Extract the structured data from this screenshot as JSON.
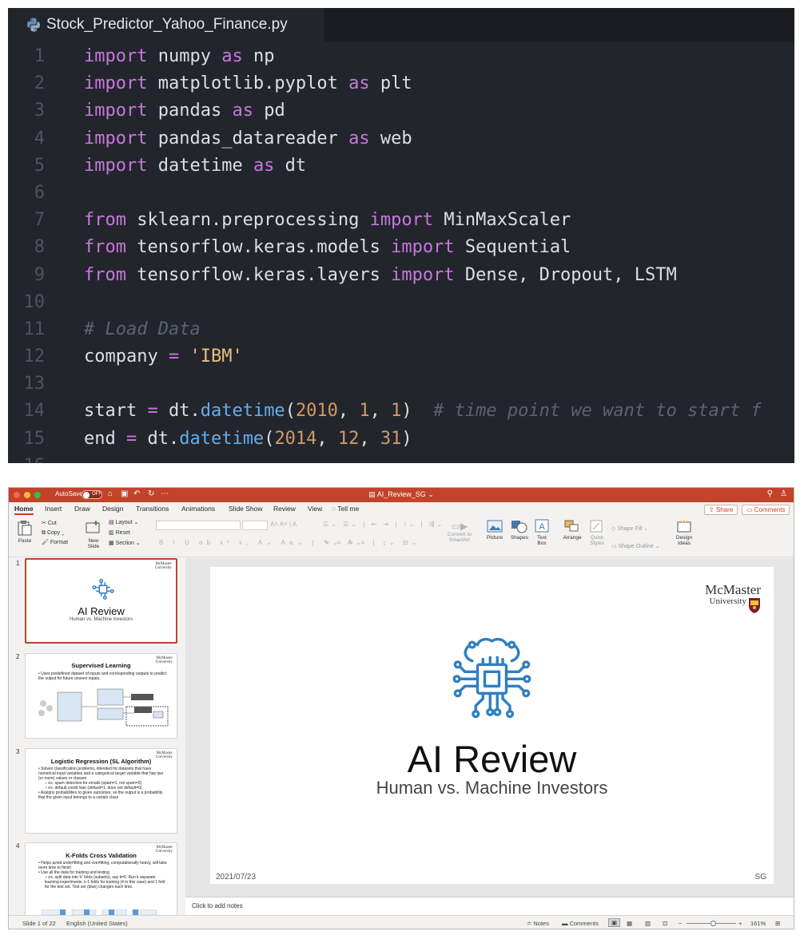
{
  "editor": {
    "filename": "Stock_Predictor_Yahoo_Finance.py",
    "lines": [
      {
        "n": "1",
        "tokens": [
          [
            "kw",
            "import"
          ],
          [
            "tx",
            " numpy "
          ],
          [
            "kw",
            "as"
          ],
          [
            "tx",
            " np"
          ]
        ]
      },
      {
        "n": "2",
        "tokens": [
          [
            "kw",
            "import"
          ],
          [
            "tx",
            " matplotlib.pyplot "
          ],
          [
            "kw",
            "as"
          ],
          [
            "tx",
            " plt"
          ]
        ]
      },
      {
        "n": "3",
        "tokens": [
          [
            "kw",
            "import"
          ],
          [
            "tx",
            " pandas "
          ],
          [
            "kw",
            "as"
          ],
          [
            "tx",
            " pd"
          ]
        ]
      },
      {
        "n": "4",
        "tokens": [
          [
            "kw",
            "import"
          ],
          [
            "tx",
            " pandas_datareader "
          ],
          [
            "kw",
            "as"
          ],
          [
            "tx",
            " web"
          ]
        ]
      },
      {
        "n": "5",
        "tokens": [
          [
            "kw",
            "import"
          ],
          [
            "tx",
            " datetime "
          ],
          [
            "kw",
            "as"
          ],
          [
            "tx",
            " dt"
          ]
        ]
      },
      {
        "n": "6",
        "tokens": []
      },
      {
        "n": "7",
        "tokens": [
          [
            "kw",
            "from"
          ],
          [
            "tx",
            " sklearn.preprocessing "
          ],
          [
            "kw",
            "import"
          ],
          [
            "tx",
            " MinMaxScaler"
          ]
        ]
      },
      {
        "n": "8",
        "tokens": [
          [
            "kw",
            "from"
          ],
          [
            "tx",
            " tensorflow.keras.models "
          ],
          [
            "kw",
            "import"
          ],
          [
            "tx",
            " Sequential"
          ]
        ]
      },
      {
        "n": "9",
        "tokens": [
          [
            "kw",
            "from"
          ],
          [
            "tx",
            " tensorflow.keras.layers "
          ],
          [
            "kw",
            "import"
          ],
          [
            "tx",
            " Dense, Dropout, LSTM"
          ]
        ]
      },
      {
        "n": "10",
        "tokens": []
      },
      {
        "n": "11",
        "tokens": [
          [
            "cm",
            "# Load Data"
          ]
        ]
      },
      {
        "n": "12",
        "tokens": [
          [
            "tx",
            "company "
          ],
          [
            "kw",
            "="
          ],
          [
            "tx",
            " "
          ],
          [
            "str",
            "'IBM'"
          ]
        ]
      },
      {
        "n": "13",
        "tokens": []
      },
      {
        "n": "14",
        "tokens": [
          [
            "tx",
            "start "
          ],
          [
            "kw",
            "="
          ],
          [
            "tx",
            " dt."
          ],
          [
            "fn",
            "datetime"
          ],
          [
            "tx",
            "("
          ],
          [
            "num",
            "2010"
          ],
          [
            "tx",
            ", "
          ],
          [
            "num",
            "1"
          ],
          [
            "tx",
            ", "
          ],
          [
            "num",
            "1"
          ],
          [
            "tx",
            ")  "
          ],
          [
            "cm",
            "# time point we want to start f"
          ]
        ]
      },
      {
        "n": "15",
        "tokens": [
          [
            "tx",
            "end "
          ],
          [
            "kw",
            "="
          ],
          [
            "tx",
            " dt."
          ],
          [
            "fn",
            "datetime"
          ],
          [
            "tx",
            "("
          ],
          [
            "num",
            "2014"
          ],
          [
            "tx",
            ", "
          ],
          [
            "num",
            "12"
          ],
          [
            "tx",
            ", "
          ],
          [
            "num",
            "31"
          ],
          [
            "tx",
            ")"
          ]
        ]
      },
      {
        "n": "16",
        "tokens": []
      }
    ]
  },
  "ppt": {
    "autosave_label": "AutoSave",
    "autosave_state": "OFF",
    "doc_title": "AI_Review_SG",
    "tabs": [
      "Home",
      "Insert",
      "Draw",
      "Design",
      "Transitions",
      "Animations",
      "Slide Show",
      "Review",
      "View",
      "Tell me"
    ],
    "share_label": "Share",
    "comments_label": "Comments",
    "ribbon": {
      "paste": "Paste",
      "cut": "Cut",
      "copy": "Copy",
      "format": "Format",
      "new_slide_1": "New",
      "new_slide_2": "Slide",
      "layout": "Layout",
      "reset": "Reset",
      "section": "Section",
      "convert_1": "Convert to",
      "convert_2": "SmartArt",
      "picture": "Picture",
      "shapes": "Shapes",
      "textbox_1": "Text",
      "textbox_2": "Box",
      "arrange": "Arrange",
      "quick_1": "Quick",
      "quick_2": "Styles",
      "shape_fill": "Shape Fill",
      "shape_outline": "Shape Outline",
      "design_1": "Design",
      "design_2": "Ideas"
    },
    "thumbnails": [
      {
        "num": "1",
        "title": "AI Review",
        "sub": "Human vs. Machine Investors"
      },
      {
        "num": "2",
        "title": "Supervised Learning",
        "bullets": [
          "Uses predefined dataset of inputs and corresponding outputs to predict the output for future unseen inputs."
        ]
      },
      {
        "num": "3",
        "title": "Logistic Regression (SL Algorithm)",
        "bullets": [
          "Solves classification problems, intended for datasets that have numerical input variables and a categorical target variable that has two (or more) values or classes",
          "ex. spam detection for emails (spam=1, not spam=0)",
          "ex. default credit loan (default=1, does not default=0)",
          "Assigns probabilities to given outcomes; so the output is a probability that the given input belongs to a certain class"
        ]
      },
      {
        "num": "4",
        "title": "K-Folds Cross Validation",
        "bullets": [
          "Helps avoid underfitting and overfitting, computationally heavy, will take more time to finish",
          "Use all the data for training and testing",
          "ex. split data into 'k' folds (subsets), say k=5. Run k separate learning experiments. k-1 folds for training (4 in this case) and 1 fold for the test set. Test set (blue) changes each time."
        ]
      }
    ],
    "logo_line1": "McMaster",
    "logo_line2": "University",
    "slide_title": "AI Review",
    "slide_subtitle": "Human vs. Machine Investors",
    "slide_date": "2021/07/23",
    "slide_author": "SG",
    "notes_placeholder": "Click to add notes",
    "status": {
      "slide_of": "Slide 1 of 22",
      "language": "English (United States)",
      "notes": "Notes",
      "comments": "Comments",
      "zoom": "161%"
    },
    "colors": {
      "accent": "#c1432a",
      "icon_blue": "#2e7fc2"
    }
  }
}
